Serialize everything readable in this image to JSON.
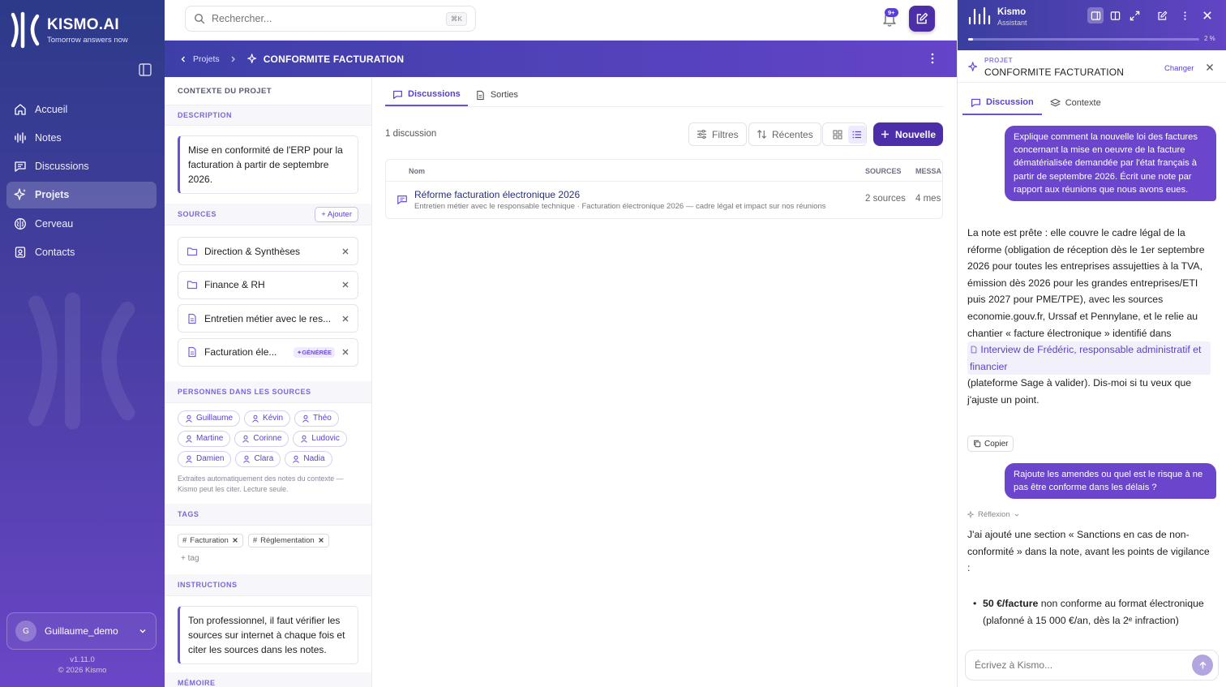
{
  "sidebar": {
    "brand": {
      "name": "KISMO.AI",
      "tagline": "Tomorrow answers now"
    },
    "nav": [
      {
        "label": "Accueil",
        "icon": "home-icon",
        "active": false
      },
      {
        "label": "Notes",
        "icon": "waveform-icon",
        "active": false
      },
      {
        "label": "Discussions",
        "icon": "chat-icon",
        "active": false
      },
      {
        "label": "Projets",
        "icon": "sparkle-icon",
        "active": true
      },
      {
        "label": "Cerveau",
        "icon": "brain-icon",
        "active": false
      },
      {
        "label": "Contacts",
        "icon": "contact-icon",
        "active": false
      }
    ],
    "user": {
      "initial": "G",
      "name": "Guillaume_demo"
    },
    "version": "v1.11.0",
    "copyright": "© 2026 Kismo"
  },
  "topbar": {
    "search_placeholder": "Rechercher...",
    "search_shortcut": "⌘K",
    "notification_badge": "9+"
  },
  "project_header": {
    "breadcrumb": "Projets",
    "title": "CONFORMITE FACTURATION"
  },
  "context": {
    "title": "CONTEXTE DU PROJET",
    "description_label": "DESCRIPTION",
    "description": "Mise en conformité de l'ERP pour la facturation à partir de septembre 2026.",
    "sources_label": "SOURCES",
    "add_label": "Ajouter",
    "sources": [
      {
        "label": "Direction & Synthèses",
        "type": "folder",
        "badge": ""
      },
      {
        "label": "Finance & RH",
        "type": "folder",
        "badge": ""
      },
      {
        "label": "Entretien métier avec le res...",
        "type": "doc",
        "badge": ""
      },
      {
        "label": "Facturation éle...",
        "type": "doc",
        "badge": "GÉNÉRÉE"
      }
    ],
    "people_label": "PERSONNES DANS LES SOURCES",
    "people": [
      "Guillaume",
      "Kévin",
      "Théo",
      "Martine",
      "Corinne",
      "Ludovic",
      "Damien",
      "Clara",
      "Nadia"
    ],
    "people_note": "Extraites automatiquement des notes du contexte — Kismo peut les citer. Lecture seule.",
    "tags_label": "TAGS",
    "tags": [
      "Facturation",
      "Réglementation"
    ],
    "add_tag": "+ tag",
    "instructions_label": "INSTRUCTIONS",
    "instructions": "Ton professionnel, il faut vérifier les sources sur internet à chaque fois et citer les sources dans les notes.",
    "memory_label": "MÉMOIRE"
  },
  "main": {
    "tabs": [
      {
        "label": "Discussions",
        "active": true
      },
      {
        "label": "Sorties",
        "active": false
      }
    ],
    "count": "1 discussion",
    "filters_label": "Filtres",
    "sort_label": "Récentes",
    "new_label": "Nouvelle",
    "table": {
      "headers": {
        "name": "Nom",
        "sources": "SOURCES",
        "messages": "MESSA"
      },
      "rows": [
        {
          "title": "Réforme facturation électronique 2026",
          "subtitle": "Entretien métier avec le responsable technique · Facturation électronique 2026 — cadre légal et impact sur nos réunions",
          "sources": "2 sources",
          "messages": "4 mes"
        }
      ]
    }
  },
  "assistant": {
    "name": "Kismo",
    "subtitle": "Assistant",
    "progress_value": 2,
    "progress_label": "2 %",
    "project_label": "PROJET",
    "project_name": "CONFORMITE FACTURATION",
    "change_label": "Changer",
    "tabs": [
      {
        "label": "Discussion",
        "active": true
      },
      {
        "label": "Contexte",
        "active": false
      }
    ],
    "messages": {
      "user1": "Explique comment la nouvelle loi des factures concernant la mise en oeuvre de la facture dématérialisée demandée par l'état français à partir de septembre 2026. Écrit une note par rapport aux réunions que nous avons eues.",
      "reply1_a": "La note est prête : elle couvre le cadre légal de la réforme (obligation de réception dès le 1er septembre 2026 pour toutes les entreprises assujetties à la TVA, émission dès 2026 pour les grandes entreprises/ETI puis 2027 pour PME/TPE), avec les sources economie.gouv.fr, Urssaf et Pennylane, et le relie au chantier « facture électronique » identifié dans",
      "reply1_ref": "Interview de Frédéric, responsable administratif et financier",
      "reply1_b": "(plateforme Sage à valider). Dis-moi si tu veux que j'ajuste un point.",
      "copy_label": "Copier",
      "user2": "Rajoute les amendes ou quel est le risque à ne pas être conforme dans les délais ?",
      "reflexion_label": "Réflexion",
      "reply2_a": "J'ai ajouté une section « Sanctions en cas de non-conformité » dans la note, avant les points de vigilance :",
      "reply2_bullet_bold": "50 €/facture",
      "reply2_bullet_rest": "non conforme au format électronique (plafonné à 15 000 €/an, dès la 2ᵉ infraction)"
    },
    "composer_placeholder": "Écrivez à Kismo..."
  }
}
